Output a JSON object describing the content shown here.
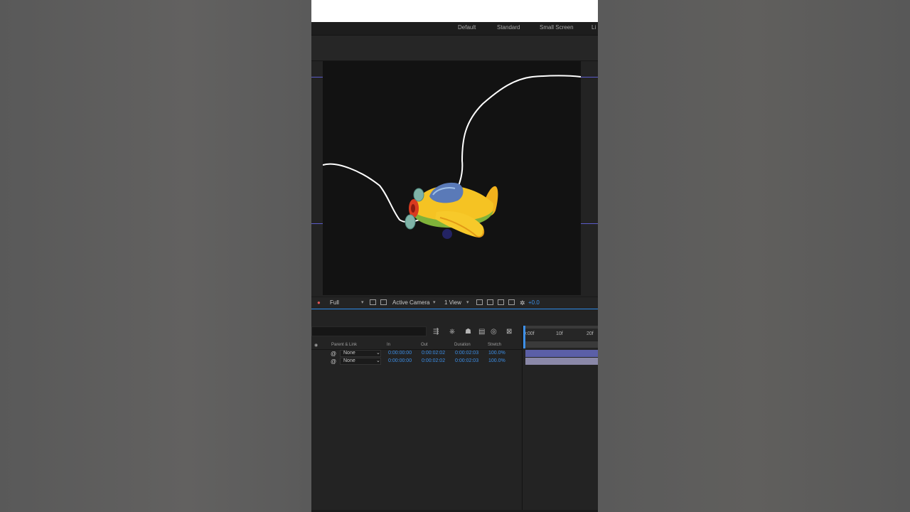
{
  "workspaces": [
    "Default",
    "Standard",
    "Small Screen",
    "Li"
  ],
  "viewer": {
    "resolution": "Full",
    "camera": "Active Camera",
    "views": "1 View",
    "exposure": "+0.0"
  },
  "timeline": {
    "headers": {
      "parent": "Parent & Link",
      "in": "In",
      "out": "Out",
      "duration": "Duration",
      "stretch": "Stretch"
    },
    "rows": [
      {
        "parent": "None",
        "in": "0:00:00:00",
        "out": "0:00:02:02",
        "duration": "0:00:02:03",
        "stretch": "100.0%"
      },
      {
        "parent": "None",
        "in": "0:00:00:00",
        "out": "0:00:02:02",
        "duration": "0:00:02:03",
        "stretch": "100.0%"
      }
    ],
    "ruler": [
      "0:00f",
      "10f",
      "20f"
    ]
  },
  "colors": {
    "accent": "#3c8fe8",
    "panel": "#232323",
    "comp": "#121212",
    "layer_bar_1": "#5b5fa7",
    "layer_bar_2": "#8a88a8"
  }
}
